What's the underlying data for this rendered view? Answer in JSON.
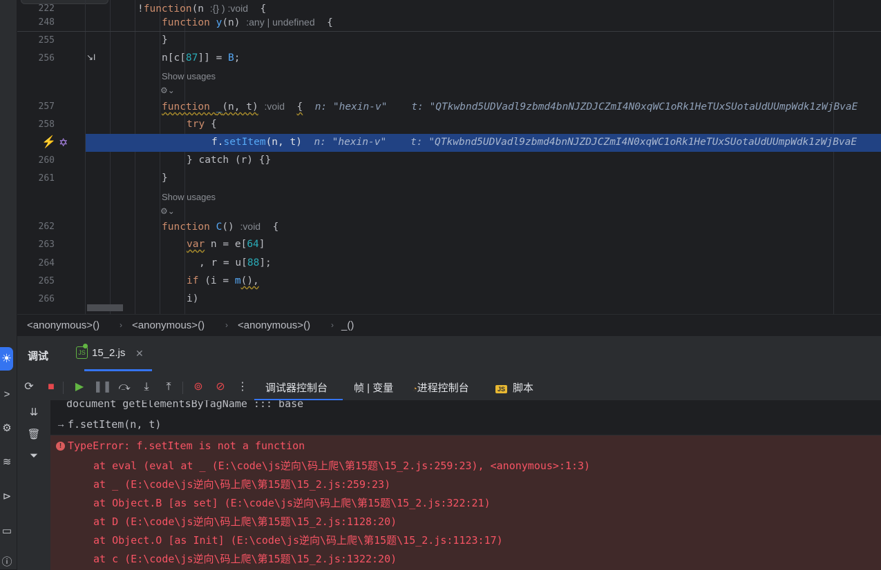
{
  "editor": {
    "lines": {
      "l222": {
        "num": "222",
        "bang": "!",
        "kw": "function",
        "sig": "(n ",
        "hint": ":{} ) :void",
        "brace": "{"
      },
      "l248": {
        "num": "248",
        "kw": "function",
        "name": "y",
        "args": "(n)",
        "hint": ":any | undefined",
        "brace": "{"
      },
      "l255": {
        "num": "255",
        "text": "}"
      },
      "l256": {
        "num": "256",
        "pre": "n[c[",
        "n1": "87",
        "post": "]] = ",
        "val": "B",
        "end": ";"
      },
      "l257": {
        "num": "257",
        "kw": "function",
        "name": "_",
        "args": "(n, t)",
        "hint": ":void",
        "brace": "{",
        "inl1": "n: \"hexin-v\"",
        "inl2": "t: \"QTkwbnd5UDVadl9zbmd4bnNJZDJCZmI4N0xqWC1oRk1HeTUxSUotaUdUUmpWdk1zWjBvaE"
      },
      "l258": {
        "num": "258",
        "kw": "try",
        "brace": "{"
      },
      "l259": {
        "pre": "f.",
        "method": "setItem",
        "args": "(n, t)",
        "inl1": "n: \"hexin-v\"",
        "inl2": "t: \"QTkwbnd5UDVadl9zbmd4bnNJZDJCZmI4N0xqWC1oRk1HeTUxSUotaUdUUmpWdk1zWjBvaE"
      },
      "l260": {
        "num": "260",
        "text": "} catch (r) {}"
      },
      "l261": {
        "num": "261",
        "text": "}"
      },
      "l262": {
        "num": "262",
        "kw": "function",
        "name": "C",
        "args": "()",
        "hint": ":void",
        "brace": "{"
      },
      "l263": {
        "num": "263",
        "kw": "var",
        "mid": " n = e[",
        "n1": "64",
        "end": "]"
      },
      "l264": {
        "num": "264",
        "pre": ", r = u[",
        "n1": "88",
        "end": "];"
      },
      "l265": {
        "num": "265",
        "kw": "if",
        "mid": " (i = ",
        "fn": "m",
        "end": "(),"
      },
      "l266": {
        "num": "266",
        "text": "i)"
      }
    },
    "show_usages": "Show usages"
  },
  "breadcrumb": [
    "<anonymous>()",
    "<anonymous>()",
    "<anonymous>()",
    "_()"
  ],
  "debug": {
    "title": "调试",
    "session_tab": "15_2.js",
    "session_icon": "JS",
    "tabs": {
      "console": "调试器控制台",
      "frames": "帧 | 变量",
      "process": "进程控制台",
      "scripts": "脚本"
    },
    "scripts_icon": "JS"
  },
  "console": {
    "prev": "document getElementsByTagName ::: base",
    "input": "f.setItem(n, t)",
    "error_title": "TypeError: f.setItem is not a function",
    "stack": [
      "at eval (eval at _ (E:\\code\\js逆向\\码上爬\\第15题\\15_2.js:259:23), <anonymous>:1:3)",
      "at _ (E:\\code\\js逆向\\码上爬\\第15题\\15_2.js:259:23)",
      "at Object.B [as set] (E:\\code\\js逆向\\码上爬\\第15题\\15_2.js:322:21)",
      "at D (E:\\code\\js逆向\\码上爬\\第15题\\15_2.js:1128:20)",
      "at Object.O [as Init] (E:\\code\\js逆向\\码上爬\\第15题\\15_2.js:1123:17)",
      "at c (E:\\code\\js逆向\\码上爬\\第15题\\15_2.js:1322:20)"
    ]
  },
  "colors": {
    "accent": "#3574f0",
    "exec_line": "#214283",
    "error_text": "#f75464",
    "error_bg": "#402929",
    "breakpoint": "#e5484d"
  }
}
